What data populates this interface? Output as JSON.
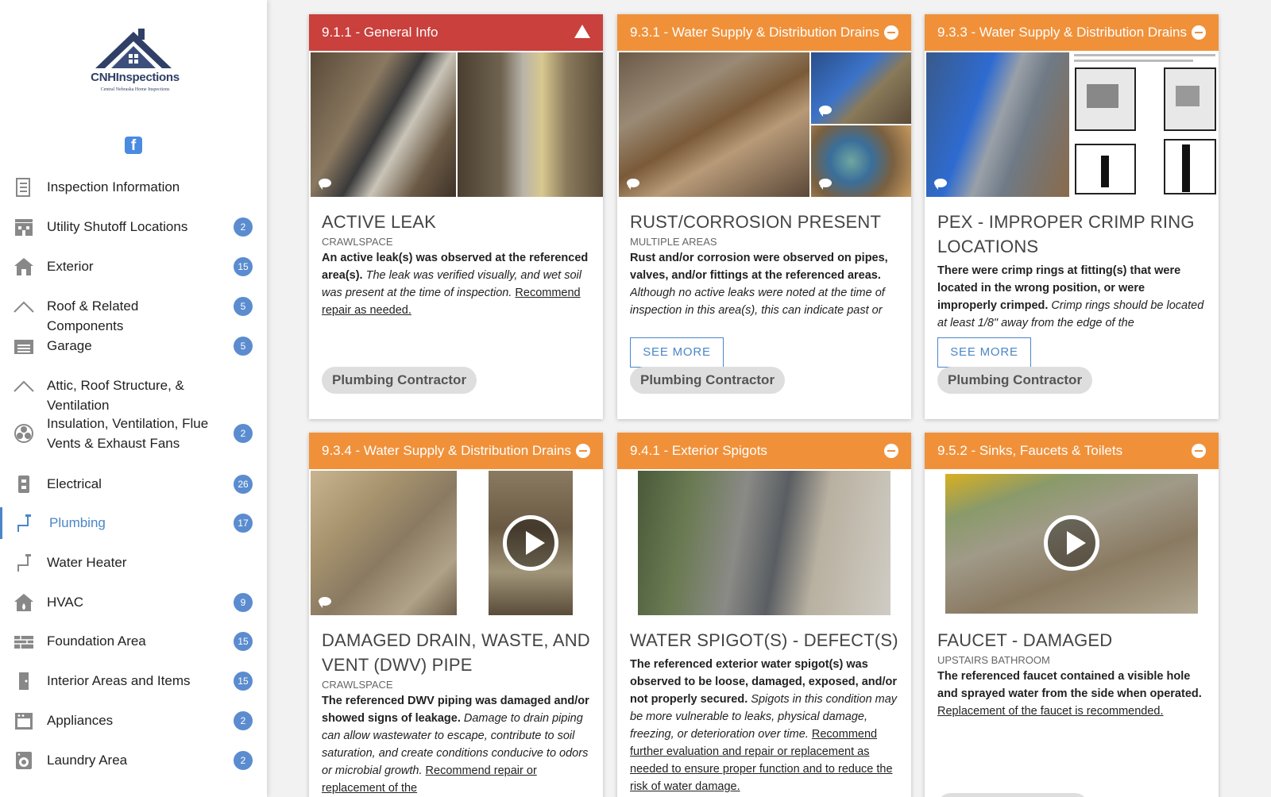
{
  "sidebar": {
    "logo_name": "CNHInspections",
    "logo_tagline": "Central Nebraska Home Inspections",
    "facebook_glyph": "f",
    "items": [
      {
        "label": "Inspection Information",
        "badge": "",
        "icon": "document-icon"
      },
      {
        "label": "Utility Shutoff Locations",
        "badge": "2",
        "icon": "building-icon"
      },
      {
        "label": "Exterior",
        "badge": "15",
        "icon": "house-icon"
      },
      {
        "label": "Roof & Related Components",
        "badge": "5",
        "icon": "roof-icon"
      },
      {
        "label": "Garage",
        "badge": "5",
        "icon": "garage-icon"
      },
      {
        "label": "Attic, Roof Structure, & Ventilation",
        "badge": "",
        "icon": "roof-icon"
      },
      {
        "label": "Insulation, Ventilation, Flue Vents & Exhaust Fans",
        "badge": "2",
        "icon": "fan-icon"
      },
      {
        "label": "Electrical",
        "badge": "26",
        "icon": "outlet-icon"
      },
      {
        "label": "Plumbing",
        "badge": "17",
        "icon": "pipe-icon",
        "active": true
      },
      {
        "label": "Water Heater",
        "badge": "",
        "icon": "pipe-icon"
      },
      {
        "label": "HVAC",
        "badge": "9",
        "icon": "flame-house-icon"
      },
      {
        "label": "Foundation Area",
        "badge": "15",
        "icon": "brick-icon"
      },
      {
        "label": "Interior Areas and Items",
        "badge": "15",
        "icon": "door-icon"
      },
      {
        "label": "Appliances",
        "badge": "2",
        "icon": "oven-icon"
      },
      {
        "label": "Laundry Area",
        "badge": "2",
        "icon": "washer-icon"
      }
    ]
  },
  "colors": {
    "accent": "#4a86c8",
    "badge": "#5b8ccf",
    "safety": "#c9403c",
    "defect": "#f0913a"
  },
  "cards": [
    {
      "header": "9.1.1 - General Info",
      "severity": "red",
      "header_icon": "warning-icon",
      "title": "ACTIVE LEAK",
      "location": "CRAWLSPACE",
      "desc_bold": "An active leak(s) was observed at the referenced area(s).",
      "desc_italic": " The leak was verified visually, and wet soil was present at the time of inspection.",
      "desc_link": "Recommend repair as needed.",
      "see_more": "",
      "pill": "Plumbing Contractor"
    },
    {
      "header": "9.3.1 - Water Supply & Distribution Drains",
      "severity": "orange",
      "header_icon": "minus-circle-icon",
      "title": "RUST/CORROSION PRESENT",
      "location": "MULTIPLE AREAS",
      "desc_bold": "Rust and/or corrosion were observed on pipes, valves, and/or fittings at the referenced areas.",
      "desc_italic": " Although no active leaks were noted at the time of inspection in this area(s), this can indicate past or present leakage and potential future",
      "desc_link": "",
      "see_more": "SEE MORE",
      "pill": "Plumbing Contractor"
    },
    {
      "header": "9.3.3 - Water Supply & Distribution Drains",
      "severity": "orange",
      "header_icon": "minus-circle-icon",
      "title": "PEX - IMPROPER CRIMP RING LOCATIONS",
      "location": "",
      "desc_bold": "There were crimp rings at fitting(s) that were located in the wrong position, or were improperly crimped.",
      "desc_italic": " Crimp rings should be located at least 1/8\" away from the edge of the",
      "desc_link": "",
      "see_more": "SEE MORE",
      "pill": "Plumbing Contractor"
    },
    {
      "header": "9.3.4 - Water Supply & Distribution Drains",
      "severity": "orange",
      "header_icon": "minus-circle-icon",
      "title": "DAMAGED DRAIN, WASTE, AND VENT (DWV) PIPE",
      "location": "CRAWLSPACE",
      "desc_bold": "The referenced DWV piping was damaged and/or showed signs of leakage.",
      "desc_italic": " Damage to drain piping can allow wastewater to escape, contribute to soil saturation, and create conditions conducive to odors or microbial growth.",
      "desc_link": "Recommend repair or replacement of the",
      "see_more": "",
      "pill": ""
    },
    {
      "header": "9.4.1 - Exterior Spigots",
      "severity": "orange",
      "header_icon": "minus-circle-icon",
      "title": "WATER SPIGOT(S) - DEFECT(S)",
      "location": "",
      "desc_bold": "The referenced exterior water spigot(s) was observed to be loose, damaged, exposed, and/or not properly secured.",
      "desc_italic": " Spigots in this condition may be more vulnerable to leaks, physical damage, freezing, or deterioration over time.",
      "desc_link": "Recommend further evaluation and repair or replacement as needed to ensure proper function and to reduce the risk of water damage.",
      "see_more": "",
      "pill": ""
    },
    {
      "header": "9.5.2 - Sinks, Faucets & Toilets",
      "severity": "orange",
      "header_icon": "minus-circle-icon",
      "title": "FAUCET - DAMAGED",
      "location": "UPSTAIRS BATHROOM",
      "desc_bold": "The referenced faucet contained a visible hole and sprayed water from the side when operated.",
      "desc_italic": " ",
      "desc_link": "Replacement of the faucet is recommended.",
      "see_more": "",
      "pill": ""
    }
  ]
}
